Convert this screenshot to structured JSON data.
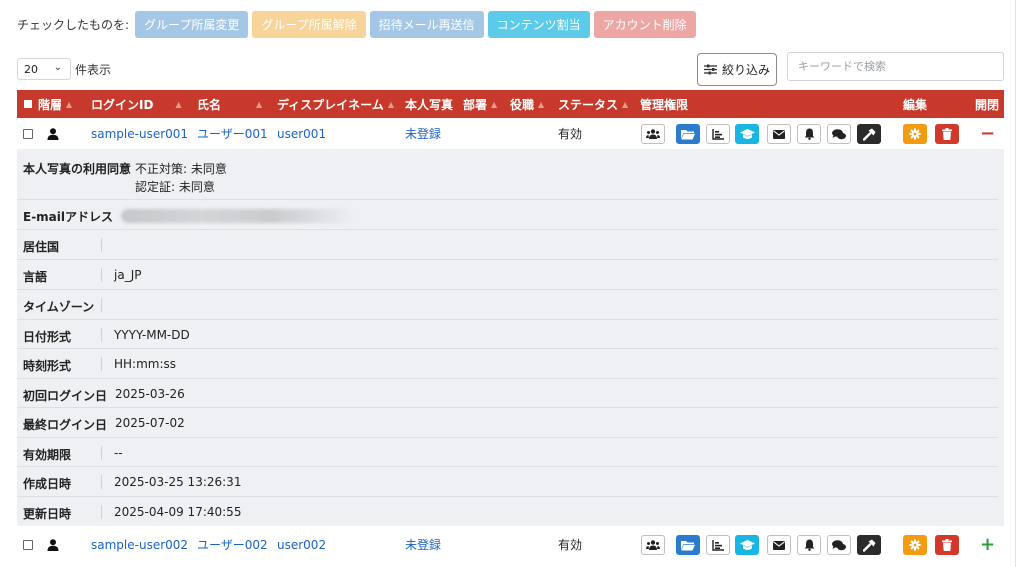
{
  "bulk_actions": {
    "label": "チェックしたものを:",
    "buttons": [
      {
        "label": "グループ所属変更",
        "color": "#a5c7e6"
      },
      {
        "label": "グループ所属解除",
        "color": "#f6d49a"
      },
      {
        "label": "招待メール再送信",
        "color": "#a5c7e6"
      },
      {
        "label": "コンテンツ割当",
        "color": "#5ccbe9"
      },
      {
        "label": "アカウント削除",
        "color": "#eca7a4"
      }
    ]
  },
  "toolbar": {
    "per_page_value": "20",
    "per_page_suffix": "件表示",
    "filter_label": "絞り込み",
    "search_placeholder": "キーワードで検索"
  },
  "table": {
    "header_color": "#c7392b",
    "columns": {
      "hierarchy": "階層",
      "login_id": "ログインID",
      "name": "氏名",
      "display_name": "ディスプレイネーム",
      "photo": "本人写真",
      "department": "部署",
      "role": "役職",
      "status": "ステータス",
      "admin": "管理権限",
      "edit": "編集",
      "expand": "開閉"
    },
    "rows": [
      {
        "login_id": "sample-user001",
        "name": "ユーザー001",
        "display_name": "user001",
        "photo": "未登録",
        "status": "有効",
        "toggle": "−"
      },
      {
        "login_id": "sample-user002",
        "name": "ユーザー002",
        "display_name": "user002",
        "photo": "未登録",
        "status": "有効",
        "toggle": "+"
      }
    ]
  },
  "detail": {
    "photo_consent_label": "本人写真の利用同意",
    "photo_consent_fraud": "不正対策: 未同意",
    "photo_consent_cert": "認定証: 未同意",
    "email_label": "E-mailアドレス",
    "country_label": "居住国",
    "country_value": "",
    "language_label": "言語",
    "language_value": "ja_JP",
    "timezone_label": "タイムゾーン",
    "timezone_value": "",
    "date_format_label": "日付形式",
    "date_format_value": "YYYY-MM-DD",
    "time_format_label": "時刻形式",
    "time_format_value": "HH:mm:ss",
    "first_login_label": "初回ログイン日",
    "first_login_value": "2025-03-26",
    "last_login_label": "最終ログイン日",
    "last_login_value": "2025-07-02",
    "expiry_label": "有効期限",
    "expiry_value": "--",
    "created_label": "作成日時",
    "created_value": "2025-03-25 13:26:31",
    "updated_label": "更新日時",
    "updated_value": "2025-04-09 17:40:55"
  }
}
